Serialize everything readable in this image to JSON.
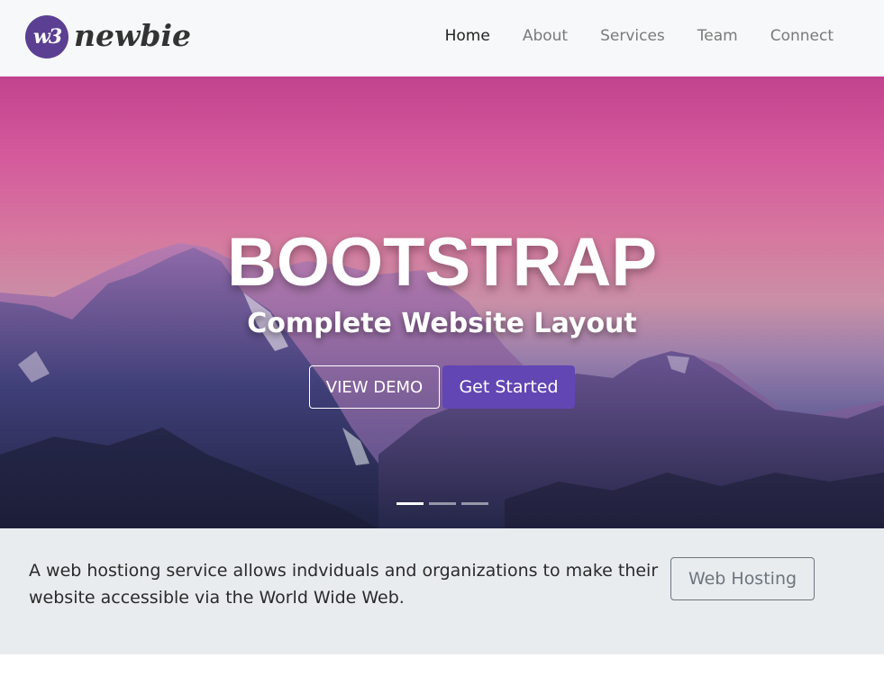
{
  "brand": {
    "mark": "w3",
    "wordmark": "newbie"
  },
  "nav": {
    "items": [
      {
        "label": "Home",
        "active": true
      },
      {
        "label": "About",
        "active": false
      },
      {
        "label": "Services",
        "active": false
      },
      {
        "label": "Team",
        "active": false
      },
      {
        "label": "Connect",
        "active": false
      }
    ]
  },
  "hero": {
    "title": "BOOTSTRAP",
    "subtitle": "Complete Website Layout",
    "buttons": {
      "demo_label": "VIEW DEMO",
      "start_label": "Get Started"
    },
    "slide_count": 3,
    "active_slide": 1
  },
  "jumbotron": {
    "text": "A web hostiong service allows indviduals and organizations to make their website accessible via the World Wide Web.",
    "button_label": "Web Hosting"
  },
  "colors": {
    "primary": "#6146b4",
    "brand": "#5a3f92",
    "navbar_bg": "#f7f8f9",
    "jumbotron_bg": "#e9ecef",
    "secondary": "#6c757d"
  }
}
